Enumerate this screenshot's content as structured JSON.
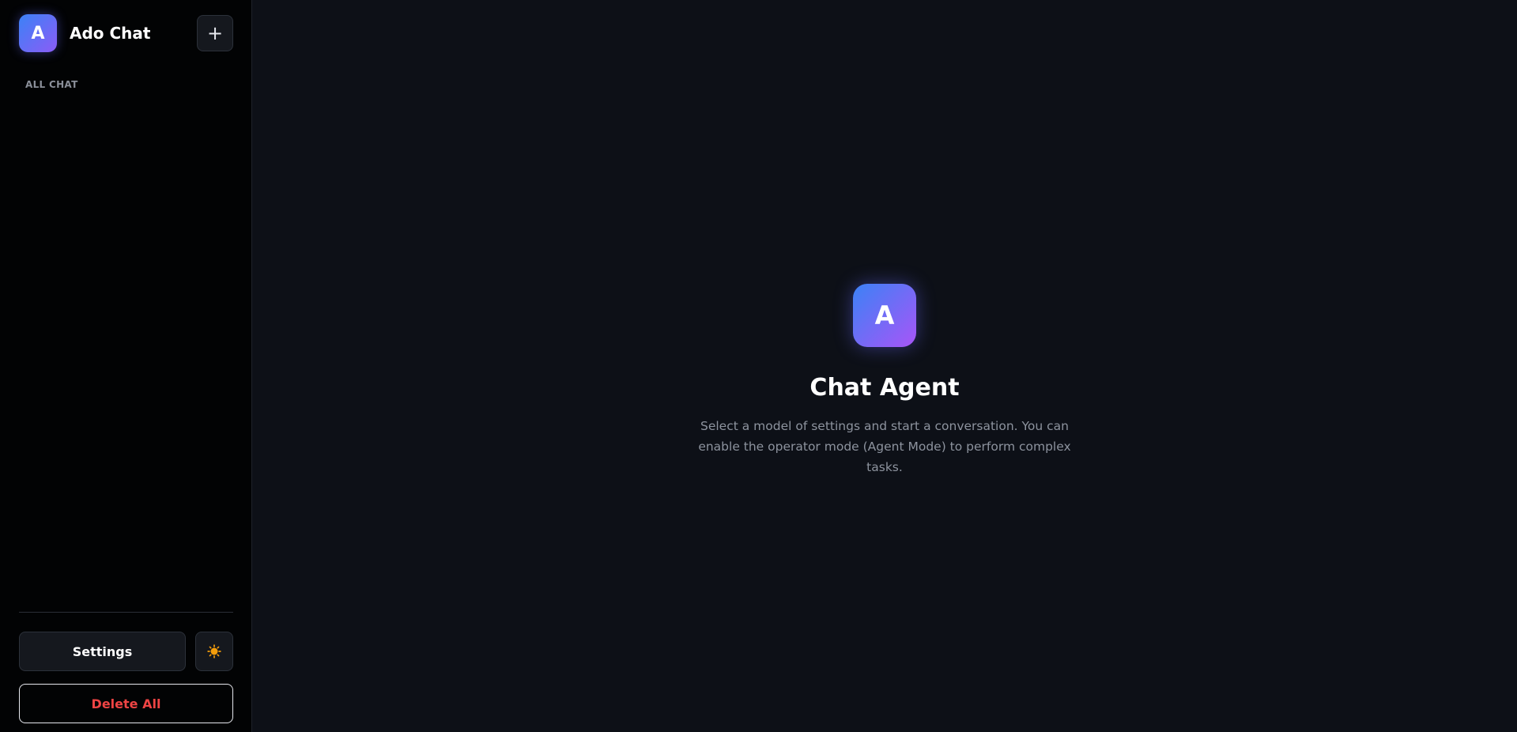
{
  "sidebar": {
    "logo_letter": "A",
    "app_name": "Ado Chat",
    "new_chat_symbol": "+",
    "section_label": "ALL CHAT",
    "chats": [],
    "settings_label": "Settings",
    "theme_icon": "sun-icon",
    "delete_all_label": "Delete All"
  },
  "main": {
    "logo_letter": "A",
    "title": "Chat Agent",
    "description": "Select a model of settings and start a conversation. You can enable the operator mode (Agent Mode) to perform complex tasks."
  },
  "colors": {
    "accent_gradient_start": "#3b82f6",
    "accent_gradient_end": "#8b5cf6",
    "danger": "#ef4444",
    "theme_icon": "#f59e0b"
  }
}
